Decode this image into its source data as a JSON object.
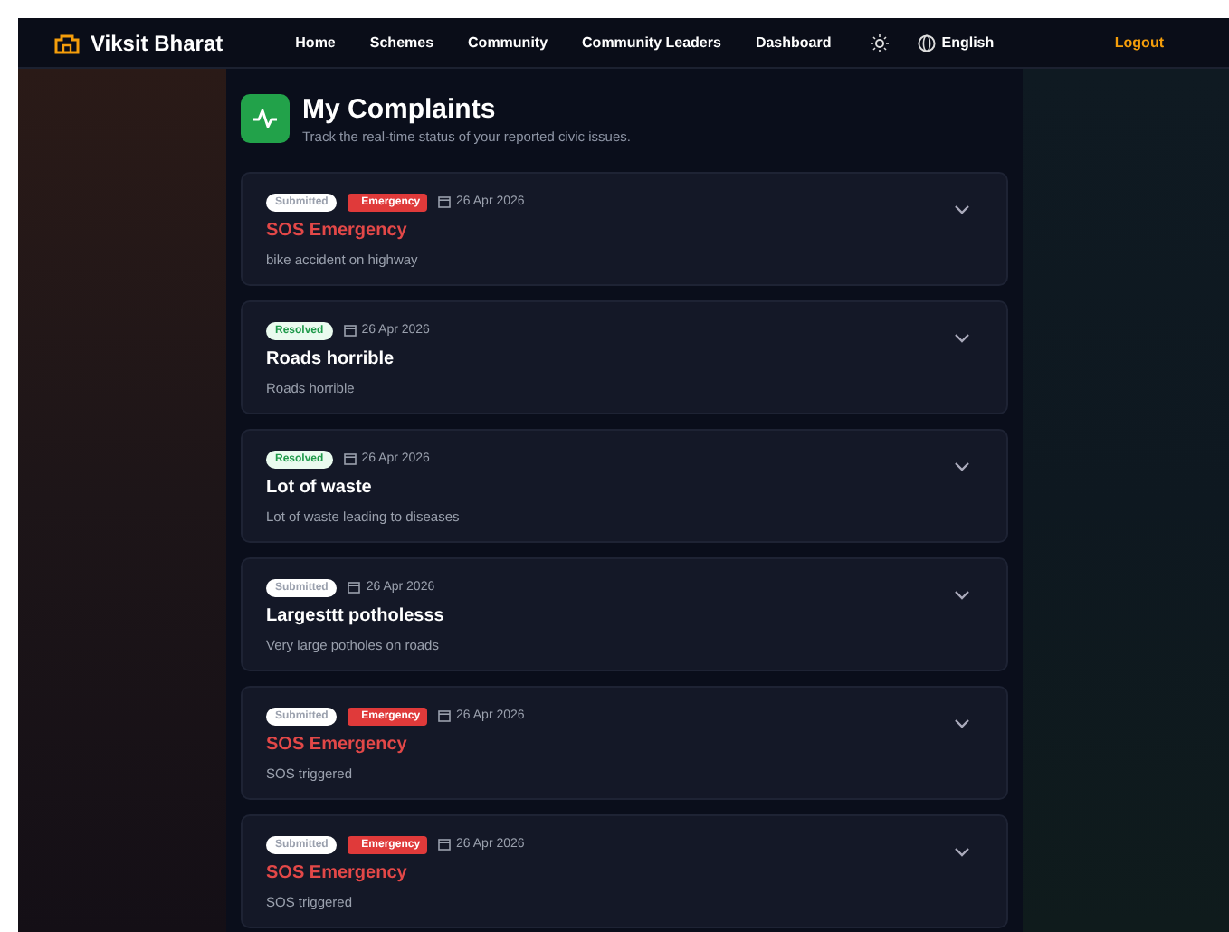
{
  "nav": {
    "brand": "Viksit Bharat",
    "links": [
      "Home",
      "Schemes",
      "Community",
      "Community Leaders",
      "Dashboard"
    ],
    "language": "English",
    "logout": "Logout"
  },
  "header": {
    "title": "My Complaints",
    "subtitle": "Track the real-time status of your reported civic issues."
  },
  "complaints": [
    {
      "status": "Submitted",
      "emergency": true,
      "emergency_label": "Emergency",
      "date": "26 Apr 2026",
      "title": "SOS Emergency",
      "description": "bike accident on highway",
      "expanded": false
    },
    {
      "status": "Resolved",
      "emergency": false,
      "date": "26 Apr 2026",
      "title": "Roads horrible",
      "description": "Roads horrible",
      "expanded": false
    },
    {
      "status": "Resolved",
      "emergency": false,
      "date": "26 Apr 2026",
      "title": "Lot of waste",
      "description": "Lot of waste leading to diseases",
      "expanded": false
    },
    {
      "status": "Submitted",
      "emergency": false,
      "date": "26 Apr 2026",
      "title": "Largesttt potholesss",
      "description": "Very large potholes on roads",
      "expanded": false
    },
    {
      "status": "Submitted",
      "emergency": true,
      "emergency_label": "Emergency",
      "date": "26 Apr 2026",
      "title": "SOS Emergency",
      "description": "SOS triggered",
      "expanded": false
    },
    {
      "status": "Submitted",
      "emergency": true,
      "emergency_label": "Emergency",
      "date": "26 Apr 2026",
      "title": "SOS Emergency",
      "description": "SOS triggered",
      "expanded": false
    }
  ]
}
